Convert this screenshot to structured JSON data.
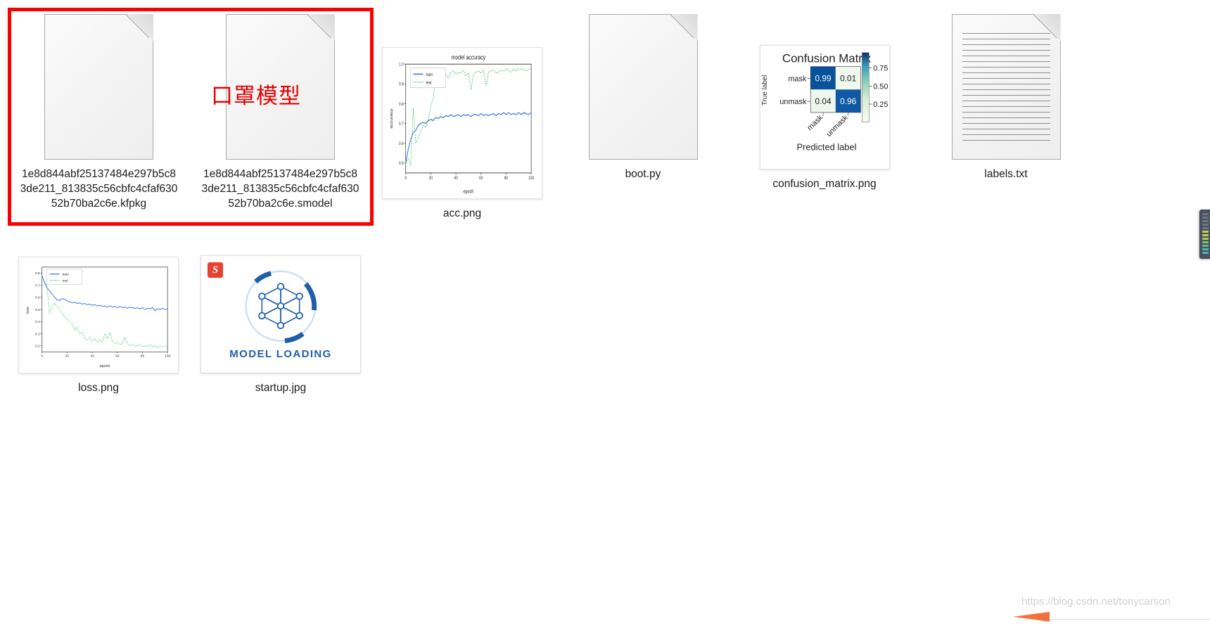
{
  "window": {
    "background": "#ffffff",
    "view": "icon-grid"
  },
  "annotation": {
    "box_color": "#fa0000",
    "text": "口罩模型",
    "text_color": "#e60000"
  },
  "files": [
    {
      "name": "1e8d844abf25137484e297b5c83de211_813835c56cbfc4cfaf63052b70ba2c6e.kfpkg",
      "icon": "blank-document-icon",
      "type": "document"
    },
    {
      "name": "1e8d844abf25137484e297b5c83de211_813835c56cbfc4cfaf63052b70ba2c6e.smodel",
      "icon": "blank-document-icon",
      "type": "document"
    },
    {
      "name": "acc.png",
      "icon": "image-thumbnail",
      "type": "chart-thumbnail"
    },
    {
      "name": "boot.py",
      "icon": "blank-document-icon",
      "type": "document"
    },
    {
      "name": "confusion_matrix.png",
      "icon": "image-thumbnail",
      "type": "chart-thumbnail"
    },
    {
      "name": "labels.txt",
      "icon": "text-document-icon",
      "type": "text-document"
    },
    {
      "name": "loss.png",
      "icon": "image-thumbnail",
      "type": "chart-thumbnail"
    },
    {
      "name": "startup.jpg",
      "icon": "image-thumbnail",
      "type": "image-thumbnail"
    }
  ],
  "startup_image": {
    "caption": "MODEL LOADING",
    "badge": "S",
    "badge_color": "#e8412f",
    "accent_color": "#1f5fa9"
  },
  "edge_meter": {
    "name": "level-meter",
    "body_color": "#4a5160",
    "segments_inactive": 9,
    "segments_yellow": 4,
    "segments_green": 5
  },
  "watermark": {
    "text": "https://blog.csdn.net/tonycarson",
    "color": "#d2d2d2",
    "arrow_color": "#f4703a"
  },
  "chart_data": [
    {
      "id": "acc",
      "type": "line",
      "title": "model accuracy",
      "xlabel": "epoch",
      "ylabel": "accuracy",
      "xlim": [
        0,
        100
      ],
      "ylim": [
        0.45,
        1.0
      ],
      "xticks": [
        0,
        20,
        40,
        60,
        80,
        100
      ],
      "yticks": [
        0.5,
        0.6,
        0.7,
        0.8,
        0.9,
        1.0
      ],
      "ytick_labels": [
        "0.5",
        "0.6",
        "0.7",
        "0.8",
        "0.9",
        "1.0"
      ],
      "grid": false,
      "legend": [
        "train",
        "test"
      ],
      "legend_position": "upper-left",
      "series": [
        {
          "name": "train",
          "color": "#3b76d9",
          "style": "solid",
          "x": [
            0,
            2,
            4,
            6,
            8,
            10,
            12,
            14,
            16,
            18,
            20,
            22,
            24,
            26,
            28,
            30,
            32,
            34,
            36,
            38,
            40,
            42,
            44,
            46,
            48,
            50,
            52,
            54,
            56,
            58,
            60,
            62,
            64,
            66,
            68,
            70,
            72,
            74,
            76,
            78,
            80,
            82,
            84,
            86,
            88,
            90,
            92,
            94,
            96,
            98,
            100
          ],
          "values": [
            0.5,
            0.57,
            0.62,
            0.655,
            0.665,
            0.69,
            0.7,
            0.705,
            0.7,
            0.715,
            0.72,
            0.715,
            0.73,
            0.725,
            0.735,
            0.73,
            0.74,
            0.735,
            0.745,
            0.735,
            0.74,
            0.745,
            0.735,
            0.745,
            0.74,
            0.745,
            0.735,
            0.745,
            0.745,
            0.74,
            0.75,
            0.74,
            0.745,
            0.74,
            0.745,
            0.75,
            0.74,
            0.75,
            0.745,
            0.755,
            0.745,
            0.755,
            0.745,
            0.75,
            0.745,
            0.755,
            0.745,
            0.755,
            0.75,
            0.745,
            0.755
          ]
        },
        {
          "name": "test",
          "color": "#3fbf73",
          "style": "dotted",
          "x": [
            0,
            2,
            4,
            6,
            8,
            10,
            12,
            14,
            16,
            18,
            20,
            22,
            24,
            26,
            28,
            30,
            32,
            34,
            36,
            38,
            40,
            42,
            44,
            46,
            48,
            50,
            52,
            54,
            56,
            58,
            60,
            62,
            64,
            66,
            68,
            70,
            72,
            74,
            76,
            78,
            80,
            82,
            84,
            86,
            88,
            90,
            92,
            94,
            96,
            98,
            100
          ],
          "values": [
            0.5,
            0.52,
            0.49,
            0.78,
            0.6,
            0.63,
            0.66,
            0.69,
            0.68,
            0.72,
            0.79,
            0.83,
            0.95,
            0.89,
            0.93,
            0.96,
            0.95,
            0.93,
            0.96,
            0.965,
            0.95,
            0.96,
            0.955,
            0.97,
            0.94,
            0.955,
            0.87,
            0.95,
            0.96,
            0.965,
            0.955,
            0.97,
            0.89,
            0.96,
            0.965,
            0.97,
            0.955,
            0.96,
            0.97,
            0.965,
            0.975,
            0.97,
            0.96,
            0.975,
            0.965,
            0.975,
            0.97,
            0.975,
            0.965,
            0.975,
            0.975
          ]
        }
      ]
    },
    {
      "id": "confusion_matrix",
      "type": "heatmap",
      "title": "Confusion Matrix",
      "xlabel": "Predicted label",
      "ylabel": "True label",
      "row_labels": [
        "mask",
        "unmask"
      ],
      "col_labels": [
        "mask",
        "unmask"
      ],
      "values": [
        [
          0.99,
          0.01
        ],
        [
          0.04,
          0.96
        ]
      ],
      "colorbar_ticks": [
        "0.25",
        "0.50",
        "0.75"
      ],
      "colormap": "GnBu",
      "cell_colors": [
        [
          "#08529c",
          "#f0f8ee"
        ],
        [
          "#eef7ec",
          "#0f59a4"
        ]
      ],
      "text_colors": [
        [
          "#ffffff",
          "#1a1a1a"
        ],
        [
          "#1a1a1a",
          "#ffffff"
        ]
      ]
    },
    {
      "id": "loss",
      "type": "line",
      "title": "",
      "xlabel": "epoch",
      "ylabel": "loss",
      "xlim": [
        0,
        100
      ],
      "ylim": [
        0.15,
        0.85
      ],
      "xticks": [
        0,
        20,
        40,
        60,
        80,
        100
      ],
      "yticks": [
        0.2,
        0.3,
        0.4,
        0.5,
        0.6,
        0.7,
        0.8
      ],
      "ytick_labels": [
        "0.2",
        "0.3",
        "0.4",
        "0.5",
        "0.6",
        "0.7",
        "0.8"
      ],
      "grid": false,
      "legend": [
        "train",
        "test"
      ],
      "legend_position": "upper-left",
      "series": [
        {
          "name": "train",
          "color": "#3b76d9",
          "style": "solid",
          "x": [
            0,
            2,
            4,
            6,
            8,
            10,
            12,
            14,
            16,
            18,
            20,
            22,
            24,
            26,
            28,
            30,
            32,
            34,
            36,
            38,
            40,
            42,
            44,
            46,
            48,
            50,
            52,
            54,
            56,
            58,
            60,
            62,
            64,
            66,
            68,
            70,
            72,
            74,
            76,
            78,
            80,
            82,
            84,
            86,
            88,
            90,
            92,
            94,
            96,
            98,
            100
          ],
          "values": [
            0.78,
            0.72,
            0.68,
            0.655,
            0.63,
            0.6,
            0.578,
            0.577,
            0.59,
            0.585,
            0.57,
            0.565,
            0.555,
            0.56,
            0.55,
            0.555,
            0.545,
            0.55,
            0.54,
            0.545,
            0.535,
            0.54,
            0.53,
            0.535,
            0.525,
            0.53,
            0.52,
            0.53,
            0.52,
            0.525,
            0.515,
            0.525,
            0.515,
            0.52,
            0.51,
            0.52,
            0.515,
            0.51,
            0.515,
            0.505,
            0.515,
            0.5,
            0.51,
            0.505,
            0.515,
            0.49,
            0.505,
            0.5,
            0.51,
            0.5,
            0.505
          ]
        },
        {
          "name": "test",
          "color": "#3fbf73",
          "style": "dotted",
          "x": [
            0,
            2,
            4,
            6,
            8,
            10,
            12,
            14,
            16,
            18,
            20,
            22,
            24,
            26,
            28,
            30,
            32,
            34,
            36,
            38,
            40,
            42,
            44,
            46,
            48,
            50,
            52,
            54,
            56,
            58,
            60,
            62,
            64,
            66,
            68,
            70,
            72,
            74,
            76,
            78,
            80,
            82,
            84,
            86,
            88,
            90,
            92,
            94,
            96,
            98,
            100
          ],
          "values": [
            0.76,
            0.73,
            0.7,
            0.47,
            0.52,
            0.55,
            0.53,
            0.5,
            0.47,
            0.44,
            0.42,
            0.4,
            0.38,
            0.33,
            0.35,
            0.3,
            0.31,
            0.26,
            0.25,
            0.27,
            0.24,
            0.26,
            0.23,
            0.25,
            0.23,
            0.3,
            0.26,
            0.31,
            0.24,
            0.22,
            0.23,
            0.21,
            0.22,
            0.27,
            0.22,
            0.2,
            0.21,
            0.195,
            0.2,
            0.21,
            0.19,
            0.2,
            0.195,
            0.21,
            0.19,
            0.2,
            0.185,
            0.2,
            0.19,
            0.2,
            0.185
          ]
        }
      ]
    }
  ]
}
